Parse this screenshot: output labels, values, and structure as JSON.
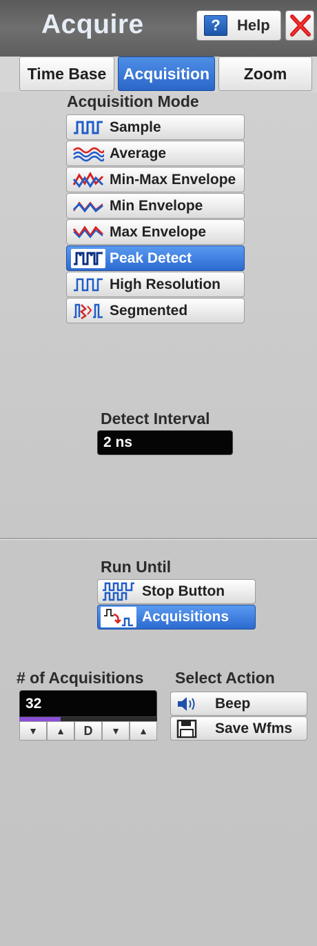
{
  "header": {
    "title": "Acquire",
    "help_label": "Help"
  },
  "tabs": [
    {
      "label": "Time Base",
      "active": false
    },
    {
      "label": "Acquisition",
      "active": true
    },
    {
      "label": "Zoom",
      "active": false
    }
  ],
  "acquisition_mode": {
    "label": "Acquisition Mode",
    "items": [
      {
        "label": "Sample",
        "icon": "sample-wave-icon"
      },
      {
        "label": "Average",
        "icon": "average-wave-icon"
      },
      {
        "label": "Min-Max Envelope",
        "icon": "min-max-envelope-icon"
      },
      {
        "label": "Min Envelope",
        "icon": "min-envelope-icon"
      },
      {
        "label": "Max Envelope",
        "icon": "max-envelope-icon"
      },
      {
        "label": "Peak Detect",
        "icon": "peak-detect-icon"
      },
      {
        "label": "High Resolution",
        "icon": "high-resolution-icon"
      },
      {
        "label": "Segmented",
        "icon": "segmented-icon"
      }
    ],
    "selected": "Peak Detect"
  },
  "detect_interval": {
    "label": "Detect Interval",
    "value": "2 ns"
  },
  "run_until": {
    "label": "Run Until",
    "options": [
      {
        "label": "Stop Button",
        "icon": "stop-button-wave-icon"
      },
      {
        "label": "Acquisitions",
        "icon": "acquisitions-icon"
      }
    ],
    "selected": "Acquisitions"
  },
  "num_acquisitions": {
    "label": "# of Acquisitions",
    "value": "32",
    "stepper": [
      "▼",
      "▲",
      "D",
      "▼",
      "▲"
    ],
    "progress_fraction": 0.3
  },
  "select_action": {
    "label": "Select Action",
    "buttons": [
      {
        "label": "Beep",
        "icon": "speaker-icon"
      },
      {
        "label": "Save Wfms",
        "icon": "floppy-disk-icon"
      }
    ]
  },
  "colors": {
    "accent": "#2c6ad0",
    "panel": "#c9c9c9",
    "header": "#6a6a6a",
    "close_red": "#d81818"
  }
}
